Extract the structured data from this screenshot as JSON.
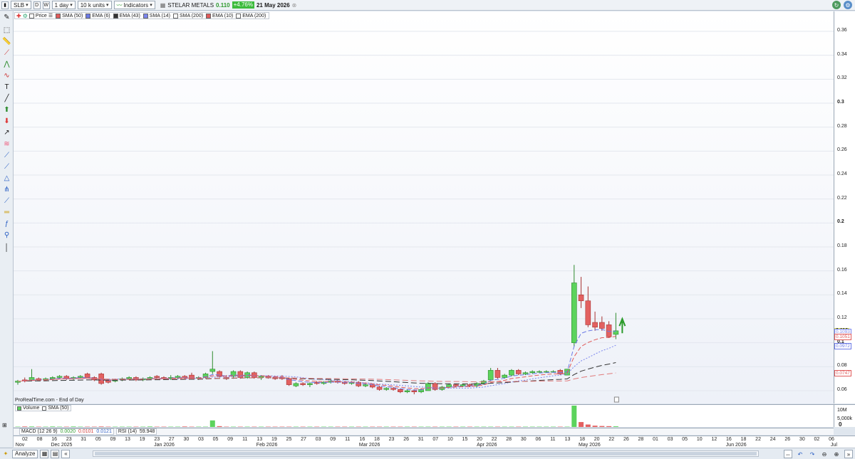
{
  "toolbar": {
    "ticker": "SLB",
    "period_d": "D",
    "period_w": "W",
    "interval": "1 day",
    "units": "10 k units",
    "indicators_label": "Indicators",
    "instrument_name": "STELAR METALS",
    "last_price": "0.110",
    "change": "+4.76%",
    "date": "21 May 2026"
  },
  "legend": {
    "price": "Price",
    "items": [
      "SMA (50)",
      "EMA (6)",
      "EMA (43)",
      "SMA (14)",
      "SMA (200)",
      "EMA (10)",
      "EMA (200)"
    ],
    "colors": [
      "#e05a5a",
      "#6b79e6",
      "#333333",
      "#7b86ee",
      "#ffffff",
      "#e05a5a",
      "#ffffff"
    ]
  },
  "yaxis": {
    "ticks": [
      "0.36",
      "0.34",
      "0.32",
      "0.3",
      "0.28",
      "0.26",
      "0.24",
      "0.22",
      "0.2",
      "0.18",
      "0.16",
      "0.14",
      "0.12",
      "0.1",
      "0.08",
      "0.06"
    ],
    "current_price_label": "0.110",
    "ma_labels": [
      "0.1093",
      "0.1051",
      "0.0972",
      "0.0747"
    ]
  },
  "footer_note": "ProRealTime.com - End of Day",
  "volume_panel": {
    "label": "Volume",
    "sma_label": "SMA (50)",
    "axis_ticks": [
      "10M",
      "5,000k",
      "0"
    ]
  },
  "indicator_bar": {
    "macd_label": "MACD (12 26 9)",
    "macd_values": [
      "0.0020",
      "0.0101",
      "0.0121"
    ],
    "rsi_label": "RSI (14)",
    "rsi_value": "59.948"
  },
  "xaxis": {
    "days": [
      "02",
      "08",
      "16",
      "23",
      "31",
      "05",
      "09",
      "13",
      "19",
      "23",
      "27",
      "30",
      "03",
      "05",
      "09",
      "11",
      "13",
      "19",
      "25",
      "27",
      "03",
      "09",
      "11",
      "16",
      "18",
      "23",
      "26",
      "31",
      "07",
      "10",
      "15",
      "20",
      "22",
      "28",
      "30",
      "06",
      "11",
      "13",
      "18",
      "20",
      "22",
      "26",
      "28",
      "01",
      "03",
      "05",
      "10",
      "12",
      "16",
      "18",
      "22",
      "24",
      "26",
      "30",
      "02",
      "06"
    ],
    "months": [
      {
        "label": "Nov",
        "day_index": 0
      },
      {
        "label": "Dec 2025",
        "day_index": 2
      },
      {
        "label": "Jan 2026",
        "day_index": 9
      },
      {
        "label": "Feb 2026",
        "day_index": 16
      },
      {
        "label": "Mar 2026",
        "day_index": 23
      },
      {
        "label": "Apr 2026",
        "day_index": 31
      },
      {
        "label": "May 2026",
        "day_index": 38
      },
      {
        "label": "Jun 2026",
        "day_index": 48
      },
      {
        "label": "Jul 2026",
        "day_index": 55
      }
    ]
  },
  "bottombar": {
    "analyze_label": "Analyze"
  },
  "chart_data": {
    "type": "candlestick",
    "ylim": [
      0.05,
      0.37
    ],
    "candles": [
      {
        "o": 0.067,
        "h": 0.069,
        "l": 0.065,
        "c": 0.068
      },
      {
        "o": 0.069,
        "h": 0.071,
        "l": 0.067,
        "c": 0.068
      },
      {
        "o": 0.069,
        "h": 0.078,
        "l": 0.068,
        "c": 0.071
      },
      {
        "o": 0.07,
        "h": 0.071,
        "l": 0.068,
        "c": 0.069
      },
      {
        "o": 0.069,
        "h": 0.071,
        "l": 0.068,
        "c": 0.07
      },
      {
        "o": 0.07,
        "h": 0.072,
        "l": 0.069,
        "c": 0.071
      },
      {
        "o": 0.071,
        "h": 0.073,
        "l": 0.07,
        "c": 0.072
      },
      {
        "o": 0.072,
        "h": 0.073,
        "l": 0.069,
        "c": 0.07
      },
      {
        "o": 0.07,
        "h": 0.072,
        "l": 0.069,
        "c": 0.071
      },
      {
        "o": 0.071,
        "h": 0.073,
        "l": 0.07,
        "c": 0.072
      },
      {
        "o": 0.074,
        "h": 0.075,
        "l": 0.072,
        "c": 0.071
      },
      {
        "o": 0.071,
        "h": 0.072,
        "l": 0.068,
        "c": 0.069
      },
      {
        "o": 0.074,
        "h": 0.075,
        "l": 0.065,
        "c": 0.066
      },
      {
        "o": 0.069,
        "h": 0.07,
        "l": 0.066,
        "c": 0.067
      },
      {
        "o": 0.068,
        "h": 0.07,
        "l": 0.067,
        "c": 0.069
      },
      {
        "o": 0.069,
        "h": 0.071,
        "l": 0.068,
        "c": 0.07
      },
      {
        "o": 0.07,
        "h": 0.072,
        "l": 0.069,
        "c": 0.071
      },
      {
        "o": 0.071,
        "h": 0.072,
        "l": 0.068,
        "c": 0.069
      },
      {
        "o": 0.069,
        "h": 0.071,
        "l": 0.068,
        "c": 0.07
      },
      {
        "o": 0.07,
        "h": 0.072,
        "l": 0.069,
        "c": 0.071
      },
      {
        "o": 0.072,
        "h": 0.073,
        "l": 0.07,
        "c": 0.071
      },
      {
        "o": 0.071,
        "h": 0.072,
        "l": 0.069,
        "c": 0.07
      },
      {
        "o": 0.07,
        "h": 0.073,
        "l": 0.069,
        "c": 0.071
      },
      {
        "o": 0.071,
        "h": 0.073,
        "l": 0.07,
        "c": 0.072
      },
      {
        "o": 0.072,
        "h": 0.073,
        "l": 0.07,
        "c": 0.071
      },
      {
        "o": 0.073,
        "h": 0.075,
        "l": 0.07,
        "c": 0.07
      },
      {
        "o": 0.071,
        "h": 0.072,
        "l": 0.069,
        "c": 0.071
      },
      {
        "o": 0.071,
        "h": 0.075,
        "l": 0.07,
        "c": 0.074
      },
      {
        "o": 0.076,
        "h": 0.093,
        "l": 0.074,
        "c": 0.078
      },
      {
        "o": 0.076,
        "h": 0.077,
        "l": 0.071,
        "c": 0.072
      },
      {
        "o": 0.071,
        "h": 0.073,
        "l": 0.069,
        "c": 0.07
      },
      {
        "o": 0.072,
        "h": 0.077,
        "l": 0.07,
        "c": 0.076
      },
      {
        "o": 0.076,
        "h": 0.077,
        "l": 0.07,
        "c": 0.071
      },
      {
        "o": 0.071,
        "h": 0.076,
        "l": 0.07,
        "c": 0.075
      },
      {
        "o": 0.075,
        "h": 0.076,
        "l": 0.07,
        "c": 0.071
      },
      {
        "o": 0.071,
        "h": 0.073,
        "l": 0.069,
        "c": 0.072
      },
      {
        "o": 0.072,
        "h": 0.073,
        "l": 0.07,
        "c": 0.071
      },
      {
        "o": 0.071,
        "h": 0.072,
        "l": 0.069,
        "c": 0.07
      },
      {
        "o": 0.071,
        "h": 0.073,
        "l": 0.069,
        "c": 0.07
      },
      {
        "o": 0.07,
        "h": 0.071,
        "l": 0.064,
        "c": 0.065
      },
      {
        "o": 0.064,
        "h": 0.067,
        "l": 0.063,
        "c": 0.066
      },
      {
        "o": 0.066,
        "h": 0.067,
        "l": 0.064,
        "c": 0.065
      },
      {
        "o": 0.065,
        "h": 0.067,
        "l": 0.063,
        "c": 0.066
      },
      {
        "o": 0.067,
        "h": 0.068,
        "l": 0.065,
        "c": 0.066
      },
      {
        "o": 0.066,
        "h": 0.068,
        "l": 0.065,
        "c": 0.067
      },
      {
        "o": 0.067,
        "h": 0.069,
        "l": 0.066,
        "c": 0.068
      },
      {
        "o": 0.068,
        "h": 0.069,
        "l": 0.066,
        "c": 0.067
      },
      {
        "o": 0.067,
        "h": 0.068,
        "l": 0.065,
        "c": 0.066
      },
      {
        "o": 0.066,
        "h": 0.068,
        "l": 0.065,
        "c": 0.067
      },
      {
        "o": 0.067,
        "h": 0.068,
        "l": 0.063,
        "c": 0.064
      },
      {
        "o": 0.064,
        "h": 0.066,
        "l": 0.063,
        "c": 0.065
      },
      {
        "o": 0.065,
        "h": 0.066,
        "l": 0.062,
        "c": 0.063
      },
      {
        "o": 0.063,
        "h": 0.064,
        "l": 0.06,
        "c": 0.061
      },
      {
        "o": 0.061,
        "h": 0.063,
        "l": 0.06,
        "c": 0.062
      },
      {
        "o": 0.062,
        "h": 0.063,
        "l": 0.06,
        "c": 0.061
      },
      {
        "o": 0.061,
        "h": 0.062,
        "l": 0.058,
        "c": 0.059
      },
      {
        "o": 0.059,
        "h": 0.061,
        "l": 0.058,
        "c": 0.06
      },
      {
        "o": 0.06,
        "h": 0.061,
        "l": 0.057,
        "c": 0.059
      },
      {
        "o": 0.059,
        "h": 0.062,
        "l": 0.058,
        "c": 0.061
      },
      {
        "o": 0.06,
        "h": 0.067,
        "l": 0.06,
        "c": 0.066
      },
      {
        "o": 0.066,
        "h": 0.067,
        "l": 0.06,
        "c": 0.061
      },
      {
        "o": 0.061,
        "h": 0.064,
        "l": 0.06,
        "c": 0.063
      },
      {
        "o": 0.063,
        "h": 0.066,
        "l": 0.062,
        "c": 0.065
      },
      {
        "o": 0.065,
        "h": 0.066,
        "l": 0.063,
        "c": 0.064
      },
      {
        "o": 0.064,
        "h": 0.066,
        "l": 0.063,
        "c": 0.065
      },
      {
        "o": 0.065,
        "h": 0.066,
        "l": 0.063,
        "c": 0.064
      },
      {
        "o": 0.064,
        "h": 0.067,
        "l": 0.063,
        "c": 0.066
      },
      {
        "o": 0.066,
        "h": 0.069,
        "l": 0.065,
        "c": 0.068
      },
      {
        "o": 0.069,
        "h": 0.079,
        "l": 0.068,
        "c": 0.077
      },
      {
        "o": 0.077,
        "h": 0.079,
        "l": 0.07,
        "c": 0.071
      },
      {
        "o": 0.071,
        "h": 0.074,
        "l": 0.07,
        "c": 0.073
      },
      {
        "o": 0.073,
        "h": 0.078,
        "l": 0.072,
        "c": 0.077
      },
      {
        "o": 0.077,
        "h": 0.078,
        "l": 0.073,
        "c": 0.074
      },
      {
        "o": 0.074,
        "h": 0.076,
        "l": 0.073,
        "c": 0.075
      },
      {
        "o": 0.075,
        "h": 0.077,
        "l": 0.074,
        "c": 0.076
      },
      {
        "o": 0.076,
        "h": 0.077,
        "l": 0.075,
        "c": 0.076
      },
      {
        "o": 0.076,
        "h": 0.077,
        "l": 0.075,
        "c": 0.076
      },
      {
        "o": 0.076,
        "h": 0.077,
        "l": 0.075,
        "c": 0.076
      },
      {
        "o": 0.077,
        "h": 0.078,
        "l": 0.073,
        "c": 0.074
      },
      {
        "o": 0.073,
        "h": 0.078,
        "l": 0.073,
        "c": 0.078
      },
      {
        "o": 0.1,
        "h": 0.165,
        "l": 0.097,
        "c": 0.15
      },
      {
        "o": 0.14,
        "h": 0.155,
        "l": 0.129,
        "c": 0.135
      },
      {
        "o": 0.135,
        "h": 0.147,
        "l": 0.113,
        "c": 0.115
      },
      {
        "o": 0.117,
        "h": 0.126,
        "l": 0.11,
        "c": 0.113
      },
      {
        "o": 0.117,
        "h": 0.122,
        "l": 0.11,
        "c": 0.112
      },
      {
        "o": 0.115,
        "h": 0.118,
        "l": 0.104,
        "c": 0.105
      },
      {
        "o": 0.107,
        "h": 0.125,
        "l": 0.103,
        "c": 0.11
      }
    ],
    "volume_millions": [
      0.2,
      0.3,
      0.3,
      0.2,
      0.2,
      0.3,
      0.2,
      0.2,
      0.3,
      0.2,
      0.2,
      0.2,
      0.3,
      0.2,
      0.2,
      0.2,
      0.2,
      0.2,
      0.2,
      0.3,
      0.2,
      0.2,
      0.2,
      0.2,
      0.3,
      0.2,
      0.2,
      0.2,
      4.0,
      0.5,
      0.2,
      0.2,
      0.2,
      0.2,
      0.2,
      0.2,
      0.2,
      0.2,
      0.2,
      0.2,
      0.2,
      0.2,
      0.2,
      0.2,
      0.2,
      0.2,
      0.2,
      0.2,
      0.2,
      0.2,
      0.2,
      0.2,
      0.2,
      0.2,
      0.2,
      0.2,
      0.2,
      0.2,
      0.2,
      0.2,
      0.2,
      0.2,
      0.2,
      0.2,
      0.2,
      0.2,
      0.2,
      0.2,
      0.2,
      0.2,
      0.2,
      0.2,
      0.2,
      0.2,
      0.2,
      0.2,
      0.2,
      0.2,
      0.2,
      0.2,
      13.0,
      3.0,
      1.5,
      0.8,
      0.6,
      0.5,
      0.4
    ]
  }
}
